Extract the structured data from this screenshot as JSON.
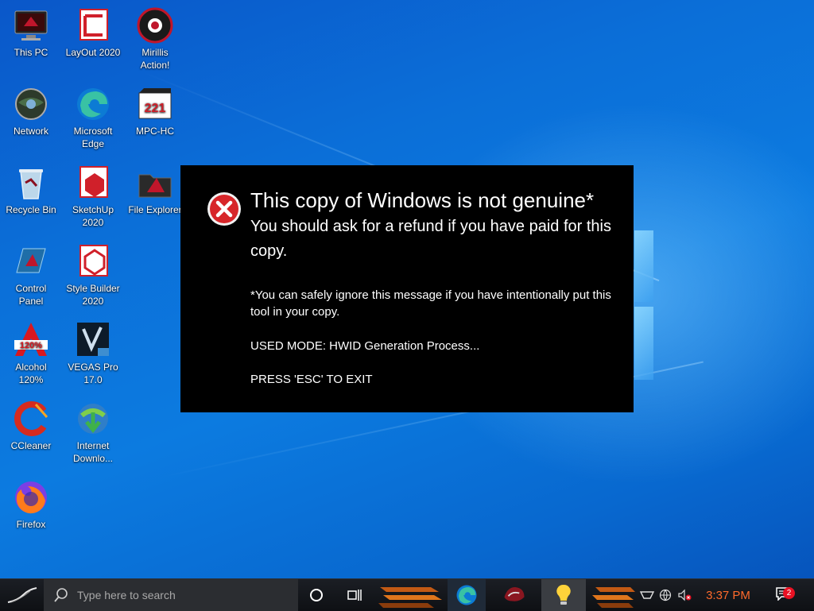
{
  "desktop": {
    "icons": [
      {
        "label": "This PC",
        "icon": "this-pc-icon"
      },
      {
        "label": "LayOut 2020",
        "icon": "layout-icon"
      },
      {
        "label": "Mirillis\nAction!",
        "icon": "mirillis-icon"
      },
      {
        "label": "Network",
        "icon": "network-icon"
      },
      {
        "label": "Microsoft\nEdge",
        "icon": "edge-icon"
      },
      {
        "label": "MPC-HC",
        "icon": "mpc-hc-icon"
      },
      {
        "label": "Recycle Bin",
        "icon": "recycle-bin-icon"
      },
      {
        "label": "SketchUp\n2020",
        "icon": "sketchup-icon"
      },
      {
        "label": "File Explorer",
        "icon": "file-explorer-icon"
      },
      {
        "label": "Control\nPanel",
        "icon": "control-panel-icon"
      },
      {
        "label": "Style Builder\n2020",
        "icon": "style-builder-icon"
      },
      {
        "label": "Alcohol\n120%",
        "icon": "alcohol-icon"
      },
      {
        "label": "VEGAS Pro\n17.0",
        "icon": "vegas-icon"
      },
      {
        "label": "CCleaner",
        "icon": "ccleaner-icon"
      },
      {
        "label": "Internet\nDownlo...",
        "icon": "idm-icon"
      },
      {
        "label": "Firefox",
        "icon": "firefox-icon"
      }
    ]
  },
  "dialog": {
    "title": "This copy of Windows is not genuine*",
    "subtitle": "You should ask for a refund if you have paid for this copy.",
    "note": "*You can safely ignore this message if you have intentionally put this tool in your copy.",
    "mode": "USED MODE: HWID Generation Process...",
    "exit": "PRESS 'ESC' TO EXIT"
  },
  "taskbar": {
    "search_placeholder": "Type here to search",
    "clock": "3:37 PM",
    "notification_count": "2"
  },
  "colors": {
    "clock": "#ff6a2b",
    "dialog_bg": "#000000",
    "error_red": "#d7262a"
  }
}
